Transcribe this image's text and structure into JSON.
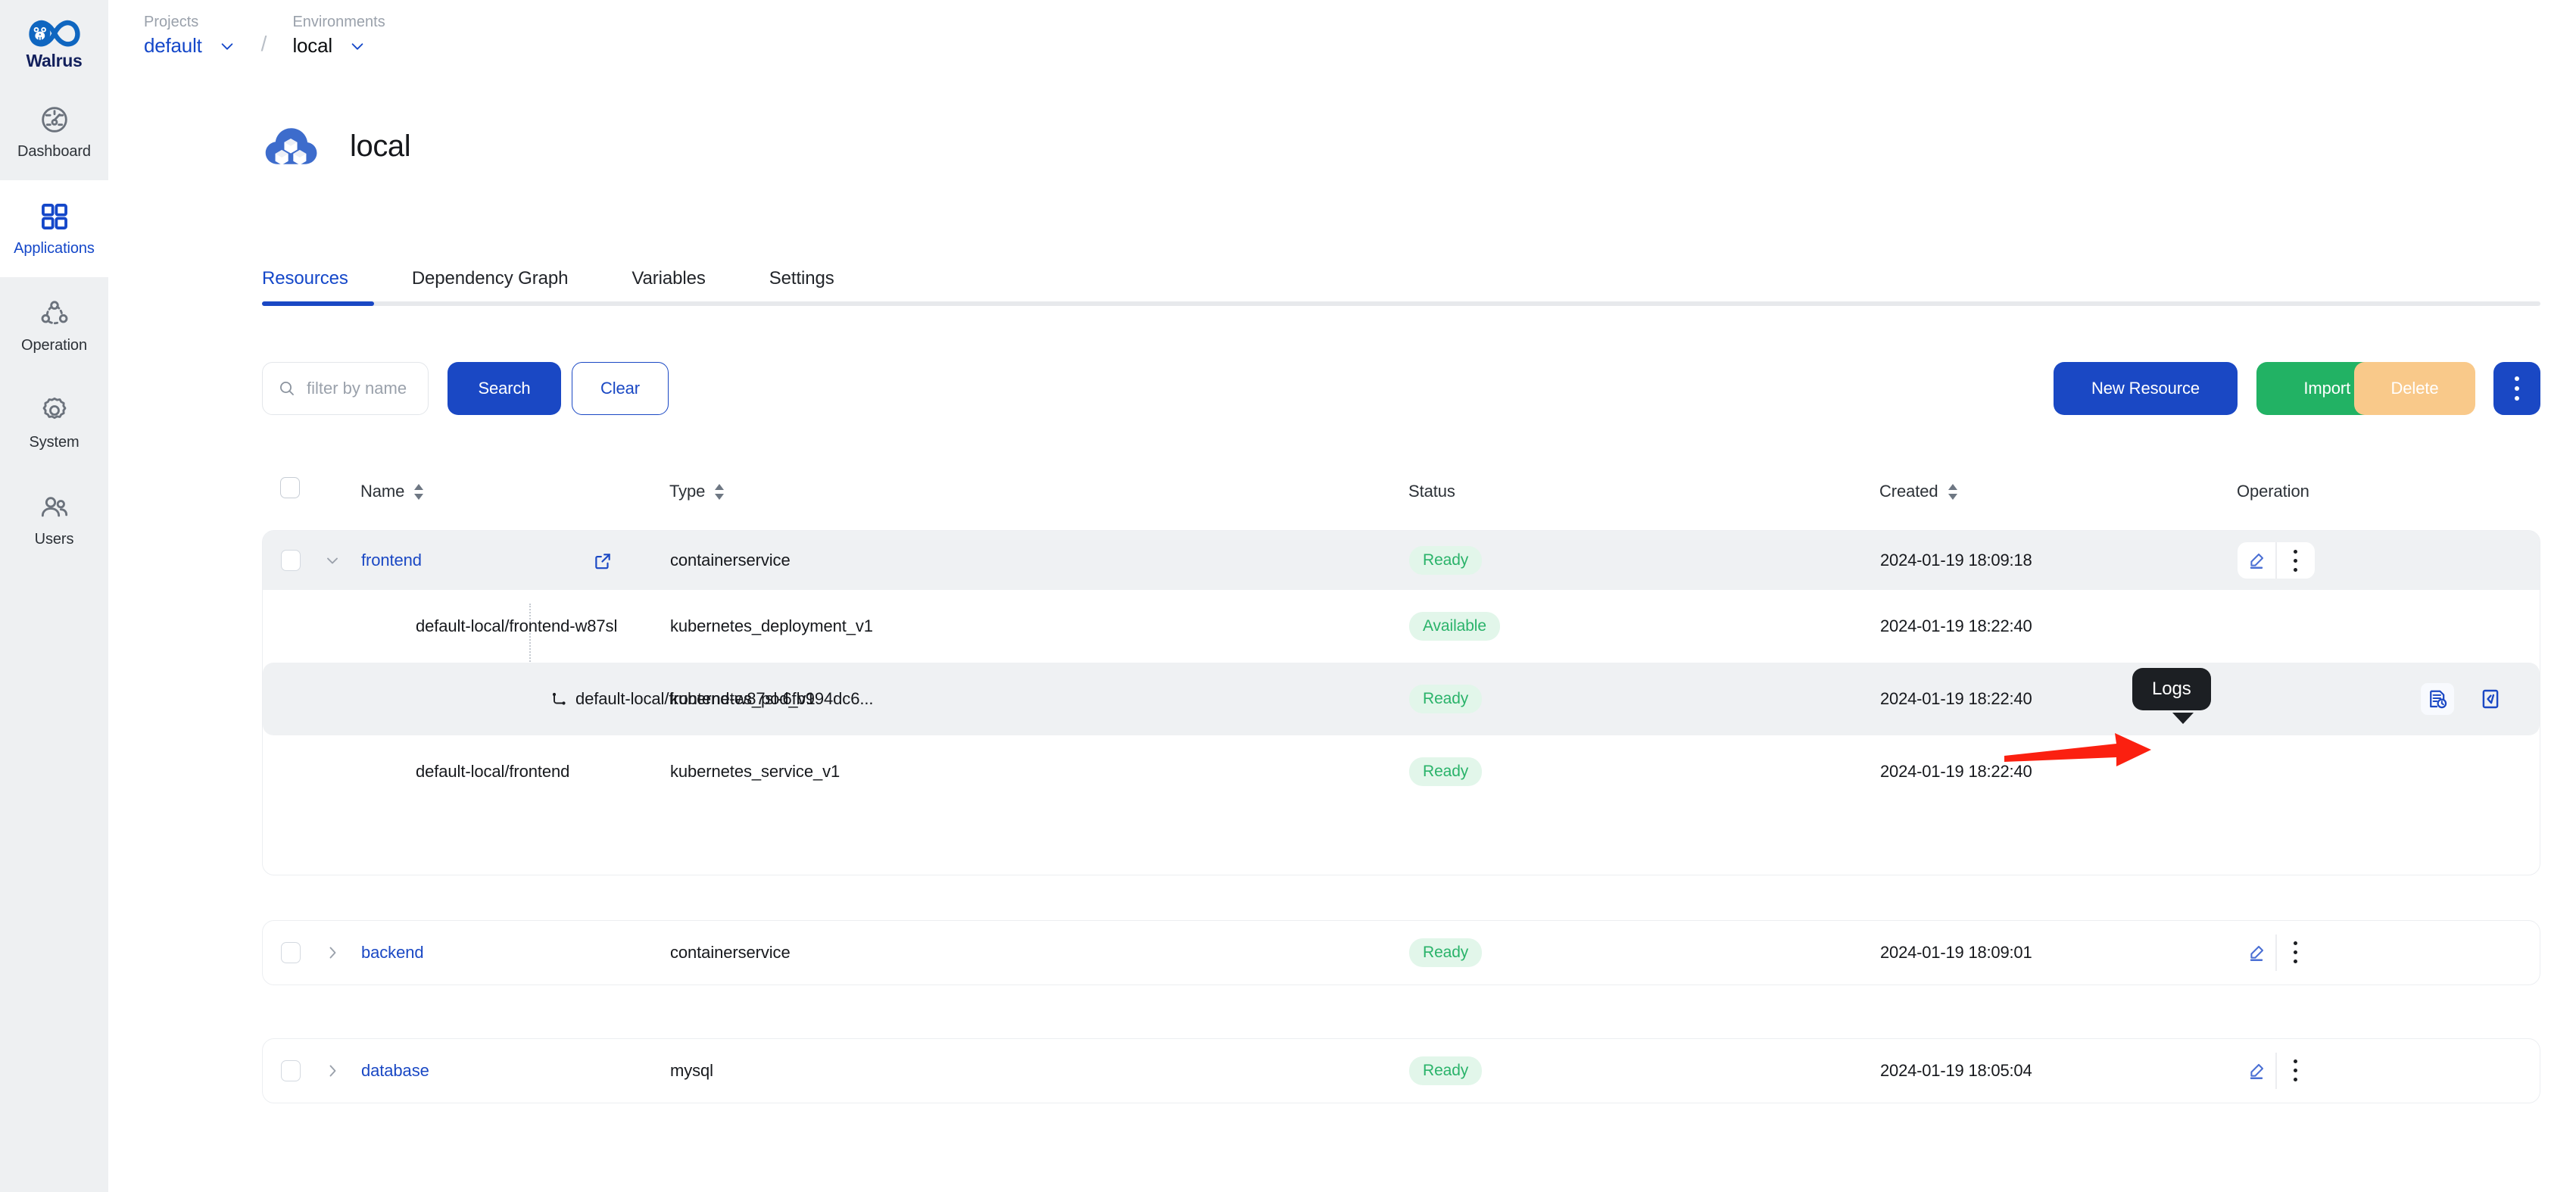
{
  "brand": {
    "name": "Walrus"
  },
  "sidebar": {
    "items": [
      {
        "label": "Dashboard",
        "icon": "dashboard-icon",
        "active": false
      },
      {
        "label": "Applications",
        "icon": "applications-icon",
        "active": true
      },
      {
        "label": "Operation",
        "icon": "operation-icon",
        "active": false
      },
      {
        "label": "System",
        "icon": "system-gear-icon",
        "active": false
      },
      {
        "label": "Users",
        "icon": "users-icon",
        "active": false
      }
    ]
  },
  "breadcrumb": {
    "project_label": "Projects",
    "project_value": "default",
    "separator": "/",
    "environment_label": "Environments",
    "environment_value": "local"
  },
  "header": {
    "title": "local",
    "icon": "cloud-cubes-icon"
  },
  "tabs": [
    {
      "label": "Resources",
      "active": true
    },
    {
      "label": "Dependency Graph",
      "active": false
    },
    {
      "label": "Variables",
      "active": false
    },
    {
      "label": "Settings",
      "active": false
    }
  ],
  "toolbar": {
    "search_placeholder": "filter by name",
    "search_value": "",
    "search_button": "Search",
    "clear_button": "Clear",
    "new_resource_button": "New Resource",
    "import_yaml_button": "Import YAML",
    "delete_button": "Delete",
    "more_button": "more-vertical-icon"
  },
  "table": {
    "columns": [
      {
        "key": "name",
        "label": "Name",
        "sortable": true
      },
      {
        "key": "type",
        "label": "Type",
        "sortable": true
      },
      {
        "key": "status",
        "label": "Status",
        "sortable": false
      },
      {
        "key": "created",
        "label": "Created",
        "sortable": true
      },
      {
        "key": "operation",
        "label": "Operation",
        "sortable": false
      }
    ],
    "groups": [
      {
        "expanded": true,
        "row": {
          "name": "frontend",
          "is_link": true,
          "external_link": true,
          "type": "containerservice",
          "status": "Ready",
          "created": "2024-01-19 18:09:18",
          "ops": [
            "edit-icon",
            "more-vertical-icon"
          ]
        },
        "children": [
          {
            "name": "default-local/frontend-w87sl",
            "type": "kubernetes_deployment_v1",
            "status": "Available",
            "created": "2024-01-19 18:22:40",
            "indent": 1,
            "ops": []
          },
          {
            "name": "default-local/frontend-w87sl-6fb994dc6...",
            "type": "kubernetes_pod_v1",
            "status": "Ready",
            "created": "2024-01-19 18:22:40",
            "indent": 2,
            "selected": true,
            "ops": [
              "logs-icon",
              "terminal-icon"
            ]
          },
          {
            "name": "default-local/frontend",
            "type": "kubernetes_service_v1",
            "status": "Ready",
            "created": "2024-01-19 18:22:40",
            "indent": 1,
            "ops": []
          }
        ]
      },
      {
        "expanded": false,
        "row": {
          "name": "backend",
          "is_link": true,
          "external_link": false,
          "type": "containerservice",
          "status": "Ready",
          "created": "2024-01-19 18:09:01",
          "ops": [
            "edit-icon",
            "more-vertical-icon"
          ]
        },
        "children": []
      },
      {
        "expanded": false,
        "row": {
          "name": "database",
          "is_link": true,
          "external_link": false,
          "type": "mysql",
          "status": "Ready",
          "created": "2024-01-19 18:05:04",
          "ops": [
            "edit-icon",
            "more-vertical-icon"
          ]
        },
        "children": []
      }
    ]
  },
  "tooltip": {
    "text": "Logs"
  },
  "annotation": {
    "type": "red-arrow",
    "points_to": "logs-icon"
  },
  "colors": {
    "brand_blue": "#1a48c4",
    "link_blue": "#1447c9",
    "green": "#22b264",
    "status_green_text": "#2ab36a",
    "status_green_bg": "#e2f6ea",
    "delete_orange": "#f9c98a",
    "sidebar_bg": "#eef0f2",
    "selected_row": "#eff1f3",
    "annotation_red": "#fb2010",
    "tooltip_bg": "#1c1f23"
  }
}
